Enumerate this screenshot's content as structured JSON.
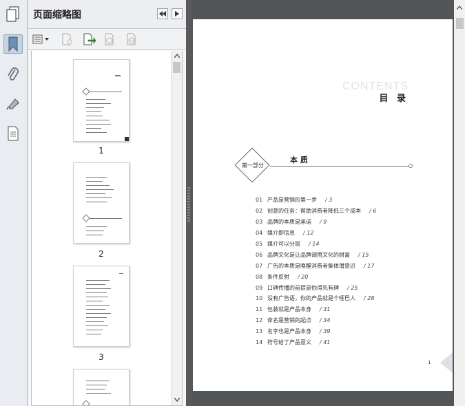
{
  "panel": {
    "title": "页面缩略图"
  },
  "icons": {
    "nav": [
      "pages-icon",
      "bookmark-icon",
      "paperclip-icon",
      "signature-icon",
      "document-layers-icon"
    ],
    "tools": [
      "options-menu-icon",
      "delete-page-icon",
      "print-page-icon",
      "enlarge-page-icon",
      "reduce-page-icon"
    ]
  },
  "thumbnails": [
    {
      "label": "1"
    },
    {
      "label": "2"
    },
    {
      "label": "3"
    }
  ],
  "document": {
    "contents_en": "CONTENTS",
    "contents_zh": "目 录",
    "part_label": "第一部分",
    "part_title": "本 质",
    "page_number": "1",
    "toc": [
      {
        "num": "01",
        "title": "产品是营销的第一步",
        "page": "/ 3"
      },
      {
        "num": "02",
        "title": "创意的任务：帮助消费者降低三个成本",
        "page": "/ 6"
      },
      {
        "num": "03",
        "title": "品牌的本质是承诺",
        "page": "/ 9"
      },
      {
        "num": "04",
        "title": "媒介即信息",
        "page": "/ 12"
      },
      {
        "num": "05",
        "title": "媒介可以分层",
        "page": "/ 14"
      },
      {
        "num": "06",
        "title": "品牌文化是让品牌调用文化的财富",
        "page": "/ 15"
      },
      {
        "num": "07",
        "title": "广告的本质是唤醒消费者集体潜意识",
        "page": "/ 17"
      },
      {
        "num": "08",
        "title": "条件反射",
        "page": "/ 20"
      },
      {
        "num": "09",
        "title": "口碑传播的前提是你得先有碑",
        "page": "/ 25"
      },
      {
        "num": "10",
        "title": "没有广告语，你的产品就是个哑巴人",
        "page": "/ 28"
      },
      {
        "num": "11",
        "title": "包装就是产品本身",
        "page": "/ 31"
      },
      {
        "num": "12",
        "title": "命名是营销的起点",
        "page": "/ 34"
      },
      {
        "num": "13",
        "title": "名字也是产品本身",
        "page": "/ 39"
      },
      {
        "num": "14",
        "title": "符号给了产品意义",
        "page": "/ 41"
      }
    ]
  }
}
